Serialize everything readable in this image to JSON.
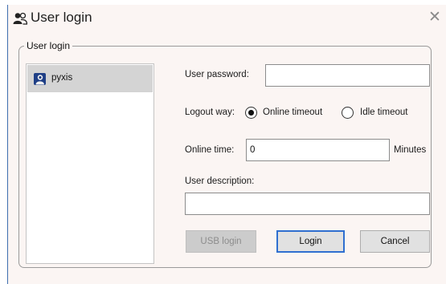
{
  "window": {
    "title": "User login",
    "close_glyph": "✕",
    "icon": "users-icon"
  },
  "group": {
    "legend": "User login"
  },
  "users": [
    {
      "name": "pyxis",
      "icon": "user-icon",
      "selected": true
    }
  ],
  "form": {
    "password_label": "User password:",
    "password_value": "",
    "logout_label": "Logout way:",
    "logout_options": [
      {
        "label": "Online timeout",
        "selected": true
      },
      {
        "label": "Idle timeout",
        "selected": false
      }
    ],
    "online_time_label": "Online time:",
    "online_time_value": "0",
    "online_time_unit": "Minutes",
    "description_label": "User description:",
    "description_value": ""
  },
  "buttons": {
    "usb": "USB login",
    "login": "Login",
    "cancel": "Cancel"
  }
}
